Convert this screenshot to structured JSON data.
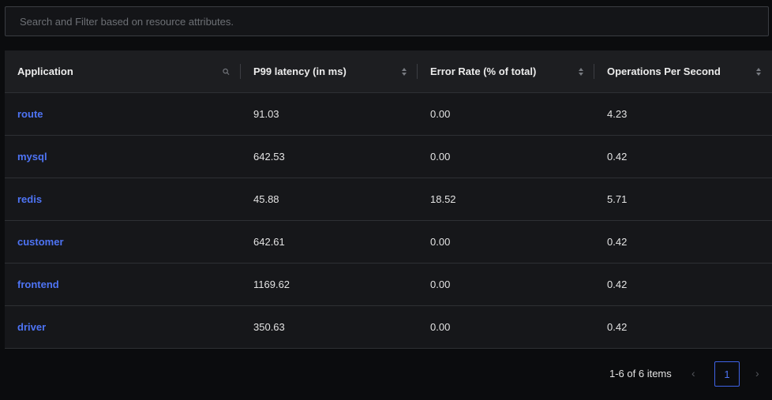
{
  "search": {
    "placeholder": "Search and Filter based on resource attributes."
  },
  "table": {
    "columns": [
      {
        "label": "Application",
        "icon": "search-icon"
      },
      {
        "label": "P99 latency (in ms)",
        "icon": "sort-icon"
      },
      {
        "label": "Error Rate (% of total)",
        "icon": "sort-icon"
      },
      {
        "label": "Operations Per Second",
        "icon": "sort-icon"
      }
    ],
    "rows": [
      {
        "application": "route",
        "p99": "91.03",
        "error_rate": "0.00",
        "ops": "4.23"
      },
      {
        "application": "mysql",
        "p99": "642.53",
        "error_rate": "0.00",
        "ops": "0.42"
      },
      {
        "application": "redis",
        "p99": "45.88",
        "error_rate": "18.52",
        "ops": "5.71"
      },
      {
        "application": "customer",
        "p99": "642.61",
        "error_rate": "0.00",
        "ops": "0.42"
      },
      {
        "application": "frontend",
        "p99": "1169.62",
        "error_rate": "0.00",
        "ops": "0.42"
      },
      {
        "application": "driver",
        "p99": "350.63",
        "error_rate": "0.00",
        "ops": "0.42"
      }
    ]
  },
  "pagination": {
    "info": "1-6 of 6 items",
    "prev": "‹",
    "next": "›",
    "current_page": "1"
  },
  "colors": {
    "link": "#4e74f5",
    "background": "#0b0c0e",
    "table_bg": "#16171a"
  }
}
